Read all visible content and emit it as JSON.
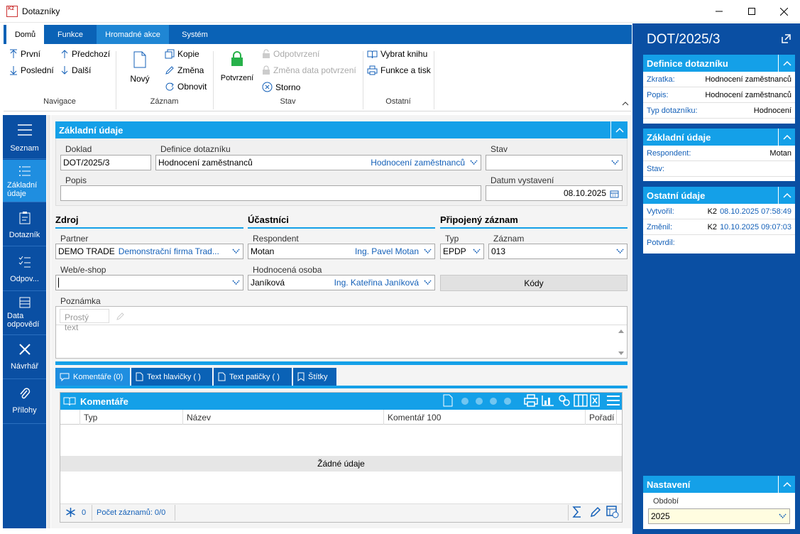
{
  "window": {
    "title": "Dotazníky",
    "app_badge": "K2"
  },
  "ribbon": {
    "tabs": [
      "Domů",
      "Funkce",
      "Hromadné akce",
      "Systém"
    ],
    "navigace": {
      "first": "První",
      "prev": "Předchozí",
      "last": "Poslední",
      "next": "Další",
      "label": "Navigace"
    },
    "zaznam": {
      "new": "Nový",
      "copy": "Kopie",
      "change": "Změna",
      "refresh": "Obnovit",
      "label": "Záznam"
    },
    "stav": {
      "confirm": "Potvrzení",
      "unconfirm": "Odpotvrzení",
      "change_date": "Změna data potvrzení",
      "cancel": "Storno",
      "label": "Stav"
    },
    "ostatni": {
      "select_book": "Vybrat knihu",
      "functions_print": "Funkce a tisk",
      "label": "Ostatní"
    }
  },
  "sidenav": [
    "Seznam",
    "Základní údaje",
    "Dotazník",
    "Odpov...",
    "Data odpovědí",
    "Návrhář",
    "Přílohy"
  ],
  "basic": {
    "title": "Základní údaje",
    "doklad_label": "Doklad",
    "doklad": "DOT/2025/3",
    "definice_label": "Definice dotazníku",
    "definice": "Hodnocení zaměstnanců",
    "definice_link": "Hodnocení zaměstnanců",
    "stav_label": "Stav",
    "stav": "",
    "popis_label": "Popis",
    "popis": "",
    "datum_label": "Datum vystavení",
    "datum": "08.10.2025"
  },
  "zdroj": {
    "title": "Zdroj",
    "partner_label": "Partner",
    "partner": "DEMO TRADE",
    "partner_link": "Demonstrační firma Trad...",
    "web_label": "Web/e-shop",
    "web": ""
  },
  "ucastnici": {
    "title": "Účastníci",
    "respondent_label": "Respondent",
    "respondent": "Motan",
    "respondent_link": "Ing. Pavel Motan",
    "hodnocena_label": "Hodnocená osoba",
    "hodnocena": "Janíková",
    "hodnocena_link": "Ing. Kateřina Janíková"
  },
  "pripojeny": {
    "title": "Připojený záznam",
    "typ_label": "Typ",
    "typ": "EPDP",
    "zaznam_label": "Záznam",
    "zaznam": "013",
    "kody": "Kódy"
  },
  "poznamka": {
    "label": "Poznámka",
    "format": "Prostý text"
  },
  "bottom_tabs": [
    "Komentáře (0)",
    "Text hlavičky ( )",
    "Text patičky ( )",
    "Štítky"
  ],
  "comments": {
    "title": "Komentáře",
    "columns": [
      "Typ",
      "Název",
      "Komentář 100",
      "Pořadí"
    ],
    "empty": "Žádné údaje",
    "count_icon_value": "0",
    "record_count": "Počet záznamů: 0/0"
  },
  "right": {
    "doc": "DOT/2025/3",
    "definice": {
      "title": "Definice dotazníku",
      "rows": [
        {
          "k": "Zkratka:",
          "v": "Hodnocení zaměstnanců"
        },
        {
          "k": "Popis:",
          "v": "Hodnocení zaměstnanců"
        },
        {
          "k": "Typ dotazníku:",
          "v": "Hodnocení"
        }
      ]
    },
    "zakladni": {
      "title": "Základní údaje",
      "rows": [
        {
          "k": "Respondent:",
          "v": "Motan"
        },
        {
          "k": "Stav:",
          "v": ""
        }
      ]
    },
    "ostatni": {
      "title": "Ostatní údaje",
      "rows": [
        {
          "k": "Vytvořil:",
          "user": "K2",
          "dt": "08.10.2025 07:58:49"
        },
        {
          "k": "Změnil:",
          "user": "K2",
          "dt": "10.10.2025 09:07:03"
        },
        {
          "k": "Potvrdil:",
          "user": "",
          "dt": ""
        }
      ]
    },
    "nastaveni": {
      "title": "Nastavení",
      "obdobi_label": "Období",
      "obdobi": "2025"
    }
  },
  "colors": {
    "accent": "#14a0e8",
    "nav": "#0a4fa3",
    "tab": "#0a62b6",
    "link": "#1460b8"
  }
}
